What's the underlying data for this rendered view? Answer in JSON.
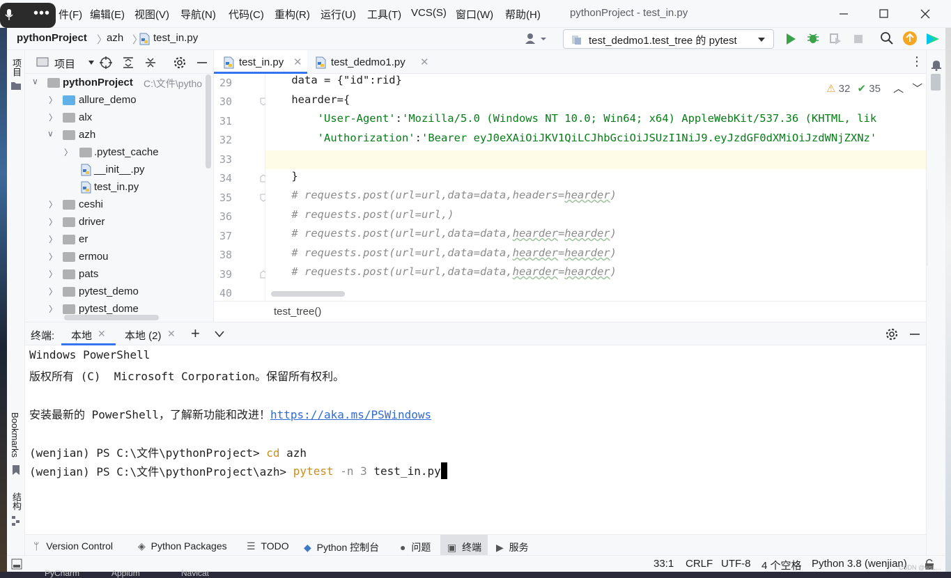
{
  "menu": {
    "items": [
      "件(F)",
      "编辑(E)",
      "视图(V)",
      "导航(N)",
      "代码(C)",
      "重构(R)",
      "运行(U)",
      "工具(T)",
      "VCS(S)",
      "窗口(W)",
      "帮助(H)"
    ],
    "window_title": "pythonProject - test_in.py"
  },
  "nav": {
    "project": "pythonProject",
    "folder": "azh",
    "file": "test_in.py",
    "run_config": "test_dedmo1.test_tree 的 pytest"
  },
  "left_strip": {
    "project_label": "项目",
    "bookmarks_label": "Bookmarks",
    "structure_label": "结构"
  },
  "project_panel": {
    "title": "项目",
    "root": {
      "name": "pythonProject",
      "path": "C:\\文件\\pytho"
    },
    "items": [
      {
        "label": "allure_demo"
      },
      {
        "label": "alx"
      },
      {
        "label": "azh"
      },
      {
        "label": ".pytest_cache"
      },
      {
        "label": "__init__.py"
      },
      {
        "label": "test_in.py"
      },
      {
        "label": "ceshi"
      },
      {
        "label": "driver"
      },
      {
        "label": "er"
      },
      {
        "label": "ermou"
      },
      {
        "label": "pats"
      },
      {
        "label": "pytest_demo"
      },
      {
        "label": "pytest_dome"
      }
    ]
  },
  "editor": {
    "tabs": [
      "test_in.py",
      "test_dedmo1.py"
    ],
    "warnings": "32",
    "passed": "35",
    "line_numbers": [
      "29",
      "30",
      "31",
      "32",
      "33",
      "34",
      "35",
      "36",
      "37",
      "38",
      "39",
      "40"
    ],
    "lines": {
      "l29": "    data = {\"id\":rid}",
      "l30": "    hearder={",
      "l31a": "        ",
      "l31b": "'User-Agent'",
      "l31c": ":",
      "l31d": "'Mozilla/5.0 (Windows NT 10.0; Win64; x64) AppleWebKit/537.36 (KHTML, lik",
      "l32b": "'Authorization'",
      "l32d": "'Bearer eyJ0eXAiOiJKV1QiLCJhbGciOiJSUzI1NiJ9.eyJzdGF0dXMiOiJzdWNjZXNz'",
      "l34": "    }",
      "l35a": "    # requests.post(url=url,data=data,headers=",
      "l35b": "hearder",
      "l35c": ")",
      "l36": "    # requests.post(url=url,)",
      "l37a": "    # requests.post(url=url,data=data,",
      "l37b": "hearder",
      "l37c": "=",
      "l37d": "hearder",
      "l37e": ")"
    },
    "breadcrumb": "test_tree()"
  },
  "terminal": {
    "label": "终端:",
    "tabs": [
      "本地",
      "本地 (2)"
    ],
    "line1": "Windows PowerShell",
    "line2": "版权所有 (C)  Microsoft Corporation。保留所有权利。",
    "line3_text": "安装最新的 PowerShell，了解新功能和改进！",
    "line3_link": "https://aka.ms/PSWindows",
    "line4_prompt": "(wenjian) PS C:\\文件\\pythonProject> ",
    "line4_cmd": "cd",
    "line4_arg": " azh",
    "line5_prompt": "(wenjian) PS C:\\文件\\pythonProject\\azh> ",
    "line5_cmd": "pytest",
    "line5_flag": " -n ",
    "line5_num": "3",
    "line5_file": " test_in.py"
  },
  "toolwindows": [
    "Version Control",
    "Python Packages",
    "TODO",
    "Python 控制台",
    "问题",
    "终端",
    "服务"
  ],
  "status": {
    "position": "33:1",
    "line_sep": "CRLF",
    "encoding": "UTF-8",
    "indent": "4 个空格",
    "interpreter": "Python 3.8 (wenjian)"
  },
  "taskbar": {
    "items": [
      "PyCharm",
      "Appium",
      "Navicat"
    ]
  },
  "watermark": "CSDN @wsL...",
  "colors": {
    "accent": "#3574f0",
    "string": "#067d17",
    "comment": "#8c8c8c",
    "run": "#3aa34a"
  }
}
